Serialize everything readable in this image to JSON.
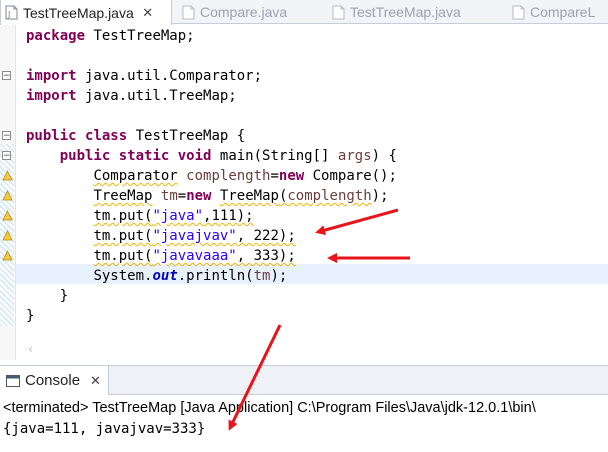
{
  "tabs": [
    {
      "label": "TestTreeMap.java",
      "close": "✕",
      "active": true
    },
    {
      "label": "Compare.java",
      "active": false
    },
    {
      "label": "TestTreeMap.java",
      "active": false
    },
    {
      "label": "CompareL",
      "active": false
    }
  ],
  "code": {
    "l1_kw": "package",
    "l1_rest": " TestTreeMap;",
    "l2_kw": "import",
    "l2_rest": " java.util.Comparator;",
    "l3_kw": "import",
    "l3_rest": " java.util.TreeMap;",
    "l4_kw1": "public",
    "l4_sp1": " ",
    "l4_kw2": "class",
    "l4_rest": " TestTreeMap {",
    "l5_indent": "    ",
    "l5_kw1": "public",
    "l5_sp1": " ",
    "l5_kw2": "static",
    "l5_sp2": " ",
    "l5_kw3": "void",
    "l5_rest1": " main(String[] ",
    "l5_var": "args",
    "l5_rest2": ") {",
    "l6_indent": "        ",
    "l6_type": "Comparator",
    "l6_sp": " ",
    "l6_var": "complength",
    "l6_eq": "=",
    "l6_kw": "new",
    "l6_rest": " Compare();",
    "l7_indent": "        ",
    "l7_type": "TreeMap",
    "l7_sp": " ",
    "l7_var": "tm",
    "l7_eq": "=",
    "l7_kw": "new",
    "l7_sp2": " ",
    "l7_type2": "TreeMap",
    "l7_open": "(",
    "l7_arg": "complength",
    "l7_close": ");",
    "l8_indent": "        ",
    "l8_pre": "tm.put(",
    "l8_str": "\"java\"",
    "l8_post": ",111);",
    "l9_indent": "        ",
    "l9_pre": "tm.put(",
    "l9_str": "\"javajvav\"",
    "l9_post": ", 222);",
    "l10_indent": "        ",
    "l10_pre": "tm.put(",
    "l10_str": "\"javavaaa\"",
    "l10_post": ", 333);",
    "l11_indent": "        ",
    "l11_pre": "System.",
    "l11_fld": "out",
    "l11_mid": ".println(",
    "l11_var": "tm",
    "l11_post": ");",
    "l12": "    }",
    "l13": "}"
  },
  "console": {
    "tab_label": "Console",
    "close": "✕",
    "status": "<terminated> TestTreeMap [Java Application] C:\\Program Files\\Java\\jdk-12.0.1\\bin\\",
    "output": "{java=111, javajvav=333}"
  },
  "colors": {
    "keyword": "#7f0055",
    "string": "#2a00ff",
    "field": "#0000c0",
    "annotation_arrow": "#e8141b",
    "current_line": "#e8f2fe"
  }
}
